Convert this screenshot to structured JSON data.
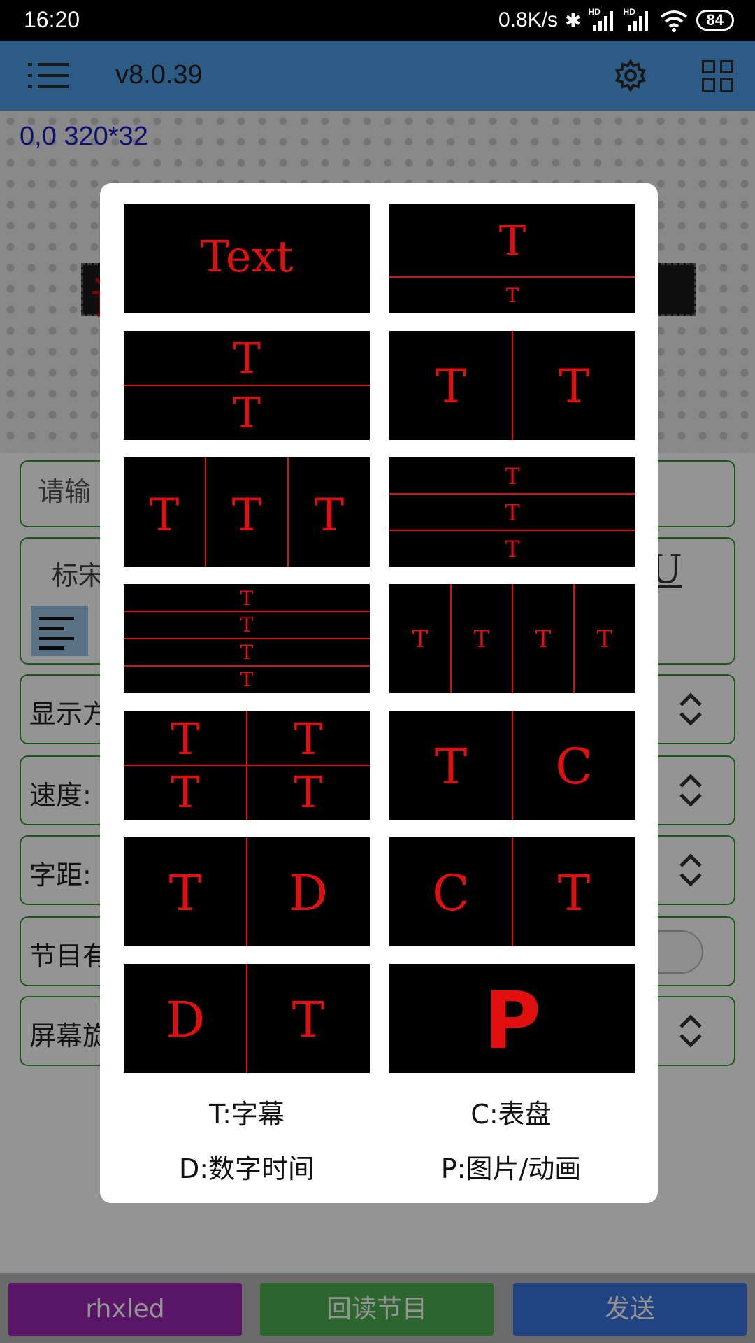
{
  "status_bar": {
    "time": "16:20",
    "net_speed": "0.8K/s",
    "bluetooth": "✱",
    "signal1": "HD",
    "signal2": "HD",
    "battery": "84"
  },
  "app_bar": {
    "version": "v8.0.39",
    "menu_icon": "menu-icon",
    "settings_icon": "gear-icon",
    "grid_icon": "grid-icon"
  },
  "canvas": {
    "coords": "0,0 320*32",
    "preview_char": "请"
  },
  "form": {
    "input_label": "请输",
    "font_label": "标宋",
    "underline_btn": "U",
    "display_label": "显示方",
    "speed_label": "速度:",
    "spacing_label": "字距:",
    "program_label": "节目有",
    "rotation_label": "屏幕旋"
  },
  "bottom_buttons": {
    "brand": "rhxled",
    "readback": "回读节目",
    "send": "发送"
  },
  "dialog": {
    "tiles": [
      {
        "id": "text",
        "labels": [
          "Text"
        ]
      },
      {
        "id": "t-t-top-bottom-small",
        "labels": [
          "T",
          "T"
        ]
      },
      {
        "id": "t-t-top-bottom",
        "labels": [
          "T",
          "T"
        ]
      },
      {
        "id": "t-t-left-right",
        "labels": [
          "T",
          "T"
        ]
      },
      {
        "id": "t-t-t-columns",
        "labels": [
          "T",
          "T",
          "T"
        ]
      },
      {
        "id": "t-t-t-rows",
        "labels": [
          "T",
          "T",
          "T"
        ]
      },
      {
        "id": "t-t-t-t-rows",
        "labels": [
          "T",
          "T",
          "T",
          "T"
        ]
      },
      {
        "id": "t-t-t-t-columns",
        "labels": [
          "T",
          "T",
          "T",
          "T"
        ]
      },
      {
        "id": "t-quad",
        "labels": [
          "T",
          "T",
          "T",
          "T"
        ]
      },
      {
        "id": "t-c",
        "labels": [
          "T",
          "C"
        ]
      },
      {
        "id": "t-d",
        "labels": [
          "T",
          "D"
        ]
      },
      {
        "id": "c-t",
        "labels": [
          "C",
          "T"
        ]
      },
      {
        "id": "d-t",
        "labels": [
          "D",
          "T"
        ]
      },
      {
        "id": "p",
        "labels": [
          "P"
        ]
      }
    ],
    "legend": {
      "t": "T:字幕",
      "c": "C:表盘",
      "d": "D:数字时间",
      "p": "P:图片/动画"
    }
  }
}
